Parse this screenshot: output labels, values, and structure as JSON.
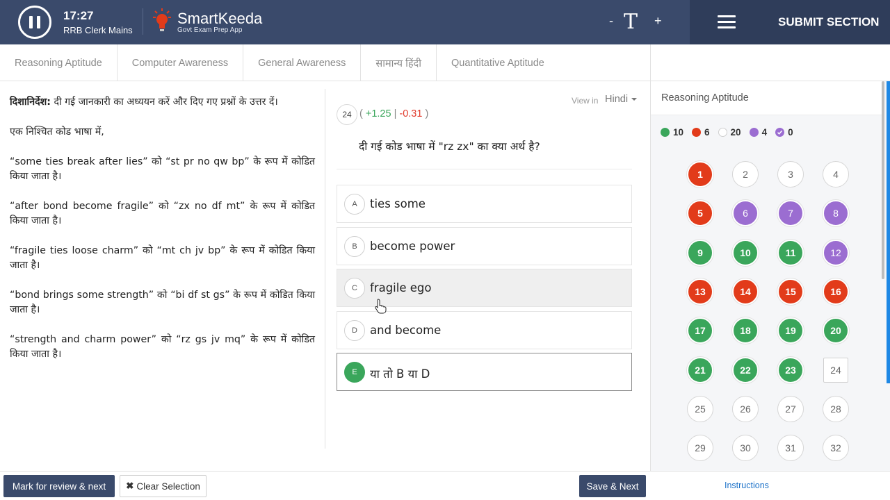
{
  "header": {
    "timer": "17:27",
    "exam_name": "RRB Clerk Mains",
    "logo_name": "SmartKeeda",
    "logo_tagline": "Govt Exam Prep App",
    "font_decrease": "-",
    "font_icon": "T",
    "font_increase": "+",
    "submit_label": "SUBMIT SECTION"
  },
  "tabs": [
    {
      "label": "Reasoning Aptitude",
      "active": true
    },
    {
      "label": "Computer Awareness"
    },
    {
      "label": "General Awareness"
    },
    {
      "label": "सामान्य हिंदी"
    },
    {
      "label": "Quantitative Aptitude"
    }
  ],
  "passage": {
    "direction_label": "दिशानिर्देश:",
    "direction_text": " दी गई जानकारी का अध्ययन करें और दिए गए प्रश्नों के उत्तर दें।",
    "paragraphs": [
      "एक निश्चित कोड भाषा में,",
      "“some ties break after lies” को “st pr no qw bp” के रूप में कोडित किया जाता है।",
      "“after bond become fragile” को “zx no df mt” के रूप में कोडित किया जाता है।",
      "“fragile ties loose charm” को “mt ch jv bp” के रूप में कोडित किया जाता है।",
      "“bond brings some strength” को “bi df st gs” के रूप में कोडित किया जाता है।",
      "“strength and charm power” को “rz gs jv mq” के रूप में कोडित किया जाता है।"
    ]
  },
  "question": {
    "number": "24",
    "marks_open": "( ",
    "positive": "+1.25",
    "separator": " | ",
    "negative": "-0.31",
    "marks_close": " )",
    "view_in_label": "View in",
    "language": "Hindi",
    "text": "दी गई कोड भाषा में \"rz zx\" का क्या अर्थ है?",
    "options": [
      {
        "letter": "A",
        "text": "ties some"
      },
      {
        "letter": "B",
        "text": "become power"
      },
      {
        "letter": "C",
        "text": "fragile ego"
      },
      {
        "letter": "D",
        "text": "and become"
      },
      {
        "letter": "E",
        "text": "या तो B या D"
      }
    ]
  },
  "palette": {
    "title": "Reasoning Aptitude",
    "legend": [
      {
        "count": "10",
        "status": "answered",
        "color": "#3aa65b"
      },
      {
        "count": "6",
        "status": "not-answered",
        "color": "#e23b1a"
      },
      {
        "count": "20",
        "status": "not-visited",
        "color": "#ffffff"
      },
      {
        "count": "4",
        "status": "marked-review",
        "color": "#9b6dd1"
      },
      {
        "count": "0",
        "status": "answered-marked-review",
        "color": "#9b6dd1"
      }
    ],
    "questions": [
      {
        "n": "1",
        "status": "notanswered"
      },
      {
        "n": "2",
        "status": "notvisited"
      },
      {
        "n": "3",
        "status": "notvisited"
      },
      {
        "n": "4",
        "status": "notvisited"
      },
      {
        "n": "5",
        "status": "notanswered"
      },
      {
        "n": "6",
        "status": "review"
      },
      {
        "n": "7",
        "status": "review"
      },
      {
        "n": "8",
        "status": "review"
      },
      {
        "n": "9",
        "status": "answered"
      },
      {
        "n": "10",
        "status": "answered"
      },
      {
        "n": "11",
        "status": "answered"
      },
      {
        "n": "12",
        "status": "review"
      },
      {
        "n": "13",
        "status": "notanswered"
      },
      {
        "n": "14",
        "status": "notanswered"
      },
      {
        "n": "15",
        "status": "notanswered"
      },
      {
        "n": "16",
        "status": "notanswered"
      },
      {
        "n": "17",
        "status": "answered"
      },
      {
        "n": "18",
        "status": "answered"
      },
      {
        "n": "19",
        "status": "answered"
      },
      {
        "n": "20",
        "status": "answered"
      },
      {
        "n": "21",
        "status": "answered"
      },
      {
        "n": "22",
        "status": "answered"
      },
      {
        "n": "23",
        "status": "answered"
      },
      {
        "n": "24",
        "status": "current"
      },
      {
        "n": "25",
        "status": "notvisited"
      },
      {
        "n": "26",
        "status": "notvisited"
      },
      {
        "n": "27",
        "status": "notvisited"
      },
      {
        "n": "28",
        "status": "notvisited"
      },
      {
        "n": "29",
        "status": "notvisited"
      },
      {
        "n": "30",
        "status": "notvisited"
      },
      {
        "n": "31",
        "status": "notvisited"
      },
      {
        "n": "32",
        "status": "notvisited"
      }
    ]
  },
  "footer": {
    "mark_review_label": "Mark for review & next",
    "clear_label": "Clear Selection",
    "clear_icon": "✖",
    "save_next_label": "Save & Next",
    "instructions_label": "Instructions"
  },
  "colors": {
    "header_bg": "#3a4a6b",
    "header_right_bg": "#2f3d5a",
    "answered": "#3aa65b",
    "not_answered": "#e23b1a",
    "review": "#9b6dd1",
    "link": "#1e73c9"
  }
}
